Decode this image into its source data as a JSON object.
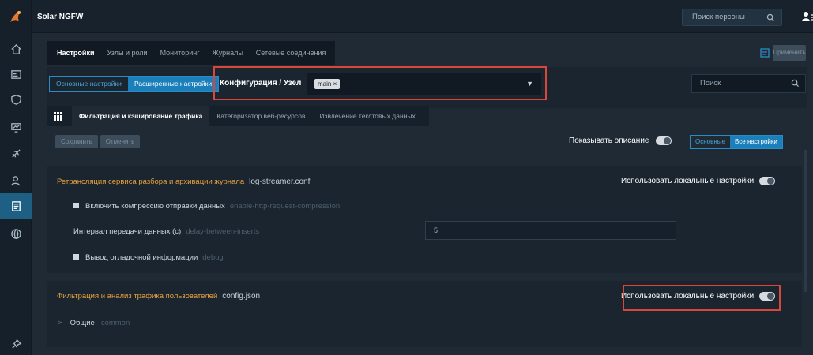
{
  "app": {
    "title": "Solar NGFW"
  },
  "header": {
    "person_search_placeholder": "Поиск персоны"
  },
  "main_tabs": [
    "Настройки",
    "Узлы и роли",
    "Мониторинг",
    "Журналы",
    "Сетевые соединения"
  ],
  "apply_label": "Применить",
  "settings_mode": [
    "Основные настройки",
    "Расширенные настройки"
  ],
  "config": {
    "label": "Конфигурация / Узел",
    "chip": "main ×"
  },
  "search_placeholder": "Поиск",
  "sub_tabs": [
    "Фильтрация и кэширование трафика",
    "Категоризатор веб-ресурсов",
    "Извлечение текстовых данных"
  ],
  "actions": {
    "save": "Сохранить",
    "cancel": "Отменить"
  },
  "show_description": "Показывать описание",
  "view_mode": [
    "Основные",
    "Все настройки"
  ],
  "card1": {
    "title": "Ретрансляция сервиса разбора и архивации журнала",
    "file": "log-streamer.conf",
    "local": "Использовать локальные настройки",
    "rows": [
      {
        "label": "Включить компрессию отправки данных",
        "key": "enable-http-request-compression"
      },
      {
        "label": "Интервал передачи данных (с)",
        "key": "delay-between-inserts",
        "value": "5"
      },
      {
        "label": "Вывод отладочной информации",
        "key": "debug"
      }
    ]
  },
  "card2": {
    "title": "Фильтрация и анализ трафика пользователей",
    "file": "config.json",
    "local": "Использовать локальные настройки",
    "section": {
      "label": "Общие",
      "key": "common"
    }
  }
}
